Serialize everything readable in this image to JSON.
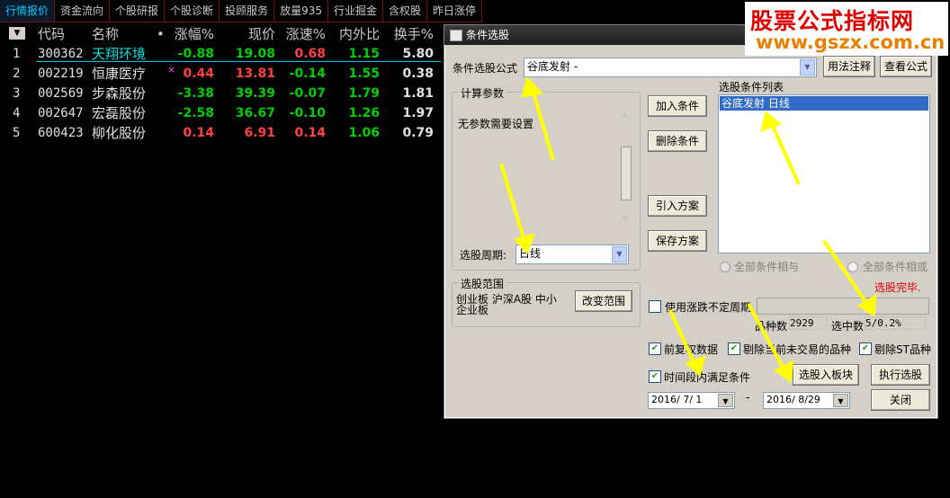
{
  "tabs": [
    {
      "label": "行情报价",
      "active": true
    },
    {
      "label": "资金流向"
    },
    {
      "label": "个股研报"
    },
    {
      "label": "个股诊断"
    },
    {
      "label": "投顾服务"
    },
    {
      "label": "放量935"
    },
    {
      "label": "行业掘金"
    },
    {
      "label": "含权股"
    },
    {
      "label": "昨日涨停"
    }
  ],
  "table": {
    "menu_glyph": "▼",
    "headers": {
      "code": "代码",
      "name": "名称",
      "dot": "•",
      "chg": "涨幅%",
      "price": "现价",
      "speed": "涨速%",
      "ratio": "内外比",
      "turnover": "换手%"
    },
    "rows": [
      {
        "idx": "1",
        "code": "300362",
        "name": "天翔环境",
        "chg": "-0.88",
        "price": "19.08",
        "speed": "0.68",
        "ratio": "1.15",
        "turnover": "5.80",
        "name_color": "#00e0e0",
        "chg_dir": "down",
        "price_dir": "down",
        "speed_dir": "up",
        "mark": ""
      },
      {
        "idx": "2",
        "code": "002219",
        "name": "恒康医疗",
        "chg": "0.44",
        "price": "13.81",
        "speed": "-0.14",
        "ratio": "1.55",
        "turnover": "0.38",
        "name_color": "#e0e0e0",
        "chg_dir": "up",
        "price_dir": "up",
        "speed_dir": "down",
        "mark": "×"
      },
      {
        "idx": "3",
        "code": "002569",
        "name": "步森股份",
        "chg": "-3.38",
        "price": "39.39",
        "speed": "-0.07",
        "ratio": "1.79",
        "turnover": "1.81",
        "name_color": "#e0e0e0",
        "chg_dir": "down",
        "price_dir": "down",
        "speed_dir": "down",
        "mark": ""
      },
      {
        "idx": "4",
        "code": "002647",
        "name": "宏磊股份",
        "chg": "-2.58",
        "price": "36.67",
        "speed": "-0.10",
        "ratio": "1.26",
        "turnover": "1.97",
        "name_color": "#e0e0e0",
        "chg_dir": "down",
        "price_dir": "down",
        "speed_dir": "down",
        "mark": ""
      },
      {
        "idx": "5",
        "code": "600423",
        "name": "柳化股份",
        "chg": "0.14",
        "price": "6.91",
        "speed": "0.14",
        "ratio": "1.06",
        "turnover": "0.79",
        "name_color": "#e0e0e0",
        "chg_dir": "up",
        "price_dir": "up",
        "speed_dir": "up",
        "mark": ""
      }
    ]
  },
  "dialog": {
    "title": "条件选股",
    "formula_label": "条件选股公式",
    "formula_value": "谷底发射        -",
    "usage_button": "用法注释",
    "view_button": "查看公式",
    "calc_params_title": "计算参数",
    "no_params_text": "无参数需要设置",
    "period_label": "选股周期:",
    "period_value": "日线",
    "add_button": "加入条件",
    "delete_button": "删除条件",
    "import_button": "引入方案",
    "save_button": "保存方案",
    "condition_list_title": "选股条件列表",
    "conditions": [
      "谷底发射   日线"
    ],
    "radio_and": "全部条件相与",
    "radio_or": "全部条件相或",
    "status_text": "选股完毕.",
    "range_title": "选股范围",
    "range_text": "创业板 沪深A股 中小企业板",
    "change_range_button": "改变范围",
    "use_period_label": "使用涨跌不定周期",
    "count_label": "品种数",
    "count_value": "2929",
    "selected_label": "选中数",
    "selected_value": "5/0.2%",
    "options": [
      {
        "label": "前复权数据",
        "checked": true
      },
      {
        "label": "剔除当前未交易的品种",
        "checked": true
      },
      {
        "label": "剔除ST品种",
        "checked": true
      }
    ],
    "time_range_label": "时间段内满足条件",
    "time_range_checked": true,
    "to_block_button": "选股入板块",
    "execute_button": "执行选股",
    "date_start": "2016/ 7/ 1",
    "date_sep": "-",
    "date_end": "2016/ 8/29",
    "close_button": "关闭"
  },
  "watermark": {
    "line1": "股票公式指标网",
    "line2": "www.gszx.com.cn"
  },
  "colors": {
    "up": "#ff4040",
    "down": "#00d000",
    "arrow": "#ffff00"
  }
}
